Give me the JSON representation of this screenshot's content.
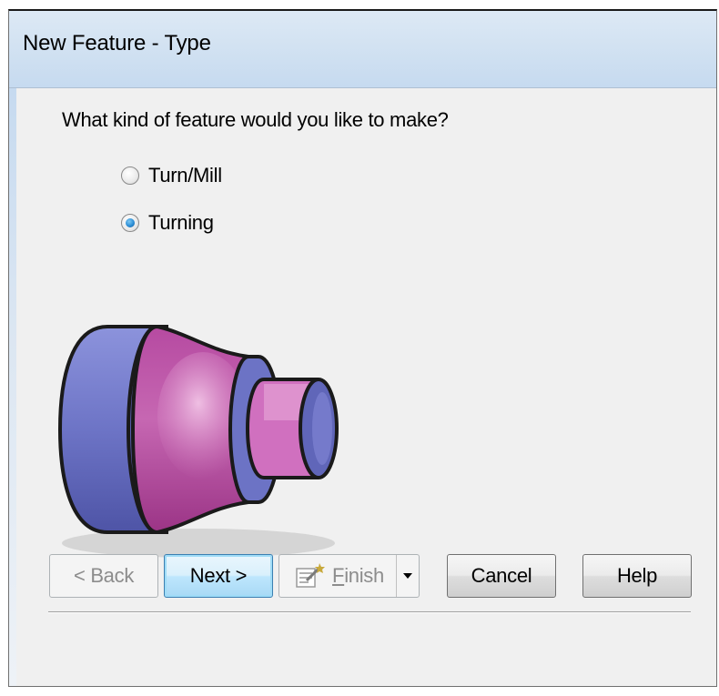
{
  "window": {
    "title": "New Feature - Type"
  },
  "main": {
    "question": "What kind of feature would you like to make?",
    "options": [
      {
        "label": "Turn/Mill",
        "selected": false
      },
      {
        "label": "Turning",
        "selected": true
      }
    ],
    "illustration_icon": "turned-part-illustration"
  },
  "buttons": {
    "back_label": "< Back",
    "next_label": "Next >",
    "finish_mnemonic": "F",
    "finish_rest": "inish",
    "cancel_label": "Cancel",
    "help_label": "Help"
  },
  "colors": {
    "blue_part": "#6f76c9",
    "magenta_part": "#c25fae",
    "pink_highlight": "#e7a8d8",
    "title_bar": "#cfe0f1"
  }
}
